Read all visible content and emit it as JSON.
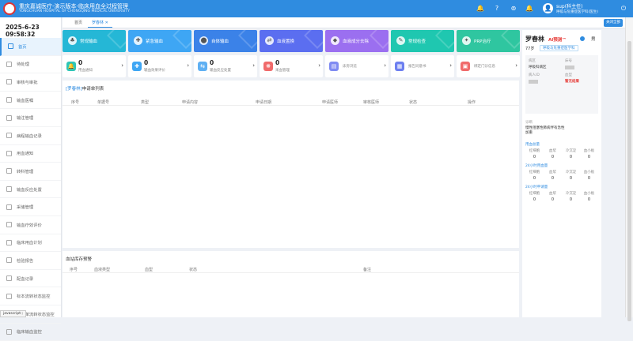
{
  "app": {
    "title": "重庆嘉诚医疗-演示版本-临床用血全过程管理",
    "subtitle": "YONGCHUAN HOSPITAL OF CHONGQING MEDICAL UNIVERSITY"
  },
  "user": {
    "name": "sup(科主任)",
    "role": "呼吸与危重症医学科(医生)"
  },
  "clock": "2025-6-23 09:58:32",
  "sidebar": {
    "items": [
      {
        "label": "首页",
        "active": true
      },
      {
        "label": "待处理"
      },
      {
        "label": "审核与审批"
      },
      {
        "label": "输血医嘱"
      },
      {
        "label": "输注管理"
      },
      {
        "label": "病程输血记录"
      },
      {
        "label": "用血通知"
      },
      {
        "label": "转科管理"
      },
      {
        "label": "输血反应处置"
      },
      {
        "label": "采储管理"
      },
      {
        "label": "输血疗效评价"
      },
      {
        "label": "临床用血计划"
      },
      {
        "label": "检验报告"
      },
      {
        "label": "配血记录"
      },
      {
        "label": "标本流转状态监控"
      },
      {
        "label": "申请单流转状态监控"
      },
      {
        "label": "临床输血监控"
      }
    ]
  },
  "tabs": {
    "home": "首页",
    "patient": "罗春林",
    "close_all": "关闭全部"
  },
  "quick_actions": [
    {
      "label": "常规输血",
      "color": "#25b7d6",
      "icon": "♣"
    },
    {
      "label": "紧急输血",
      "color": "#3ea6f4",
      "icon": "✚"
    },
    {
      "label": "自体输血",
      "color": "#3b82e8",
      "icon": "⬤"
    },
    {
      "label": "血液置换",
      "color": "#5b6ef0",
      "icon": "⇄"
    },
    {
      "label": "血液成分去除",
      "color": "#9b6ff0",
      "icon": "◆"
    },
    {
      "label": "常规检查",
      "color": "#1fc7b0",
      "icon": "✎"
    },
    {
      "label": "PRP治疗",
      "color": "#2fc6a0",
      "icon": "✦"
    }
  ],
  "stats": [
    {
      "value": "0",
      "label": "用血通知",
      "color": "#2ec5b6",
      "icon": "🔔"
    },
    {
      "value": "0",
      "label": "输血效果评价",
      "color": "#3ea6f4",
      "icon": "✚"
    },
    {
      "value": "0",
      "label": "输血反应处置",
      "color": "#5fb0f3",
      "icon": "⇆"
    },
    {
      "value": "0",
      "label": "采血管理",
      "color": "#f06a6a",
      "icon": "❋"
    },
    {
      "label": "床旁浏览",
      "color": "#7f8bf2",
      "icon": "▤"
    },
    {
      "label": "报告同意书",
      "color": "#6d7ff0",
      "icon": "▦"
    },
    {
      "label": "绑定门诊信息",
      "color": "#f06a6a",
      "icon": "▣"
    }
  ],
  "request_list": {
    "prefix": "[罗春林]",
    "title": "申请单列表",
    "columns": [
      "序号",
      "单据号",
      "类型",
      "申请内容",
      "申请日期",
      "申请医师",
      "审核医师",
      "状态",
      "操作"
    ]
  },
  "blood_bank": {
    "title": "血站库存预警",
    "columns": [
      "序号",
      "血液类型",
      "血型",
      "状态",
      "备注"
    ]
  },
  "patient": {
    "name": "罗春林",
    "ai_tag": "AI预测™",
    "sex": "男",
    "age": "77岁",
    "dept": "呼吸与危重症医学科",
    "ward_label": "病区",
    "ward_value": "呼吸科病区",
    "bed_label": "床号",
    "admit_label": "病人ID",
    "blood_label": "血型",
    "blood_value": "暂无结果",
    "dx_label": "诊断",
    "dx_value": "慢性阻塞性肺病伴有急性加重",
    "sections": [
      {
        "title": "用血总量",
        "headers": [
          "红细胞",
          "血浆",
          "冷沉淀",
          "血小板"
        ],
        "values": [
          "0",
          "0",
          "0",
          "0"
        ]
      },
      {
        "title": "24小时用血量",
        "headers": [
          "红细胞",
          "血浆",
          "冷沉淀",
          "血小板"
        ],
        "values": [
          "0",
          "0",
          "0",
          "0"
        ]
      },
      {
        "title": "24小时申请量",
        "headers": [
          "红细胞",
          "血浆",
          "冷沉淀",
          "血小板"
        ],
        "values": [
          "0",
          "0",
          "0",
          "0"
        ]
      }
    ]
  },
  "statusbar": "javascript:;"
}
